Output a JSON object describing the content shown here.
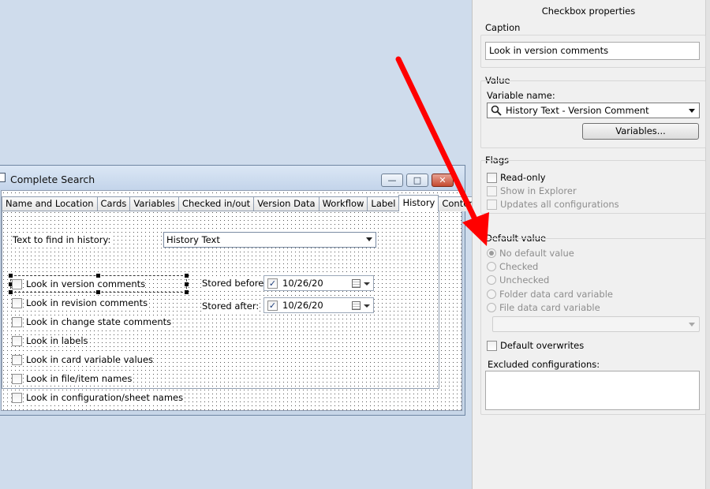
{
  "window": {
    "title": "Complete Search",
    "tabs": [
      "Name and Location",
      "Cards",
      "Variables",
      "Checked in/out",
      "Version Data",
      "Workflow",
      "Label",
      "History",
      "Content"
    ],
    "active_tab": "History",
    "text_to_find_label": "Text to find in history:",
    "text_to_find_value": "History Text",
    "checkboxes": [
      "Look in version comments",
      "Look in revision comments",
      "Look in change state comments",
      "Look in labels",
      "Look in card variable values",
      "Look in file/item names",
      "Look in configuration/sheet names"
    ],
    "stored_before_label": "Stored before:",
    "stored_before_value": "10/26/20",
    "stored_after_label": "Stored after:",
    "stored_after_value": "10/26/20"
  },
  "panel": {
    "title": "Checkbox properties",
    "caption_label": "Caption",
    "caption_value": "Look in version comments",
    "value_label": "Value",
    "variable_name_label": "Variable name:",
    "variable_name_value": "History Text - Version Comment",
    "variables_button": "Variables...",
    "flags_label": "Flags",
    "flags": [
      {
        "label": "Read-only",
        "enabled": true
      },
      {
        "label": "Show in Explorer",
        "enabled": false
      },
      {
        "label": "Updates all configurations",
        "enabled": false
      }
    ],
    "default_value_label": "Default value",
    "default_options": [
      {
        "label": "No default value",
        "selected": true
      },
      {
        "label": "Checked",
        "selected": false
      },
      {
        "label": "Unchecked",
        "selected": false
      },
      {
        "label": "Folder data card variable",
        "selected": false
      },
      {
        "label": "File data card variable",
        "selected": false
      }
    ],
    "default_overwrites": "Default overwrites",
    "excluded_configurations_label": "Excluded configurations:"
  },
  "colors": {
    "annotation_arrow": "#ff0000",
    "desktop": "#cfdcec",
    "panel": "#f0f0f0"
  }
}
